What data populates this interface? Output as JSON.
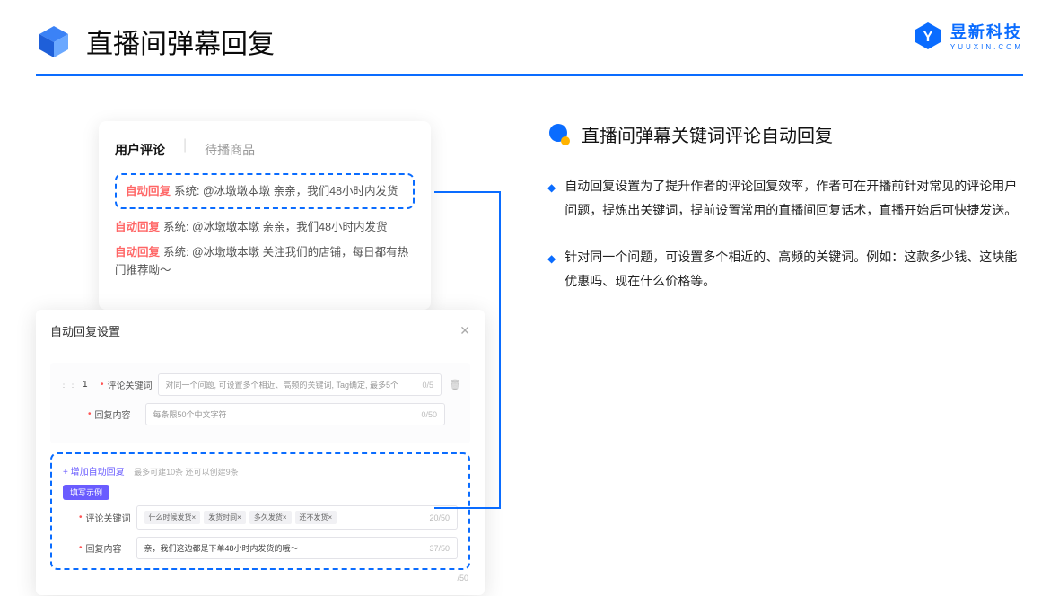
{
  "header": {
    "title": "直播间弹幕回复"
  },
  "brand": {
    "name": "昱新科技",
    "sub": "YUUXIN.COM"
  },
  "card1": {
    "tab_active": "用户评论",
    "tab_inactive": "待播商品",
    "hl_prefix": "自动回复",
    "hl_body": "系统: @冰墩墩本墩 亲亲，我们48小时内发货",
    "m2_prefix": "自动回复",
    "m2_body": "系统: @冰墩墩本墩 亲亲，我们48小时内发货",
    "m3_prefix": "自动回复",
    "m3_body": "系统: @冰墩墩本墩 关注我们的店铺，每日都有热门推荐呦～"
  },
  "card2": {
    "title": "自动回复设置",
    "idx": "1",
    "kw_label": "评论关键词",
    "kw_placeholder": "对同一个问题, 可设置多个相近、高频的关键词, Tag确定, 最多5个",
    "kw_count": "0/5",
    "content_label": "回复内容",
    "content_placeholder": "每条限50个中文字符",
    "content_count": "0/50",
    "add_text": "+ 增加自动回复",
    "add_tip": "最多可建10条 还可以创建9条",
    "ex_badge": "填写示例",
    "ex_kw_label": "评论关键词",
    "chips": [
      "什么时候发货×",
      "发货时间×",
      "多久发货×",
      "还不发货×"
    ],
    "ex_kw_count": "20/50",
    "ex_content_label": "回复内容",
    "ex_content_val": "亲，我们这边都是下单48小时内发货的哦～",
    "ex_content_count": "37/50",
    "ext_count": "/50"
  },
  "right": {
    "title": "直播间弹幕关键词评论自动回复",
    "b1": "自动回复设置为了提升作者的评论回复效率，作者可在开播前针对常见的评论用户问题，提炼出关键词，提前设置常用的直播间回复话术，直播开始后可快捷发送。",
    "b2": "针对同一个问题，可设置多个相近的、高频的关键词。例如：这款多少钱、这块能优惠吗、现在什么价格等。"
  }
}
